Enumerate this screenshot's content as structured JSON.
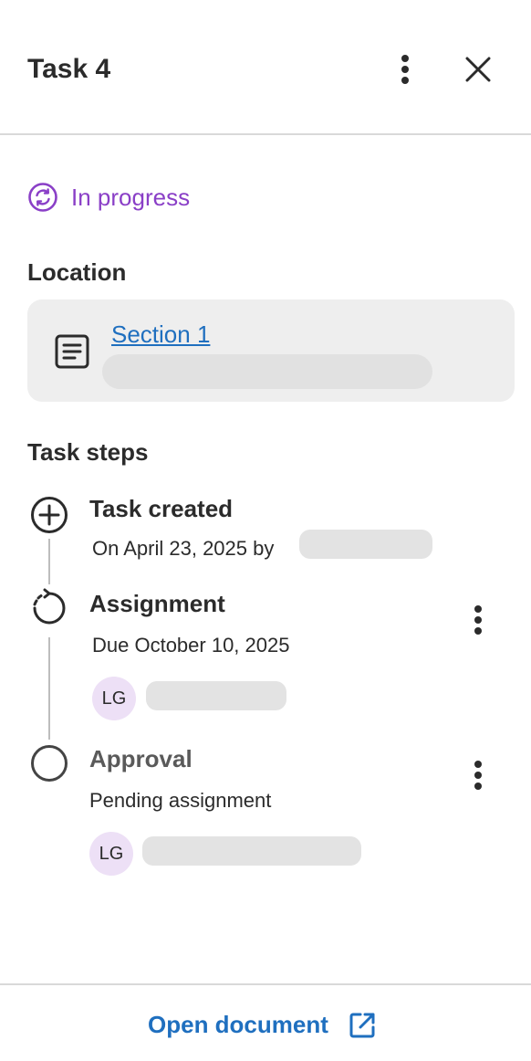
{
  "header": {
    "title": "Task 4",
    "more_icon": "kebab-vertical-icon",
    "close_icon": "close-icon"
  },
  "status": {
    "label": "In progress",
    "icon": "sync-icon",
    "color": "#8a3fc7"
  },
  "location": {
    "heading": "Location",
    "link_label": "Section 1",
    "icon": "document-icon"
  },
  "steps": {
    "heading": "Task steps",
    "items": [
      {
        "title": "Task created",
        "subtitle": "On April 23, 2025 by",
        "icon": "plus-circle-icon"
      },
      {
        "title": "Assignment",
        "subtitle": "Due October 10, 2025",
        "avatar_initials": "LG",
        "icon": "progress-rotate-icon"
      },
      {
        "title": "Approval",
        "subtitle": "Pending assignment",
        "avatar_initials": "LG",
        "icon": "empty-circle-icon"
      }
    ]
  },
  "footer": {
    "open_label": "Open document",
    "icon": "external-link-icon"
  },
  "colors": {
    "accent": "#1f6fbf",
    "status": "#8a3fc7",
    "avatar_bg": "#ede0f6",
    "divider": "#d9d9d9"
  }
}
